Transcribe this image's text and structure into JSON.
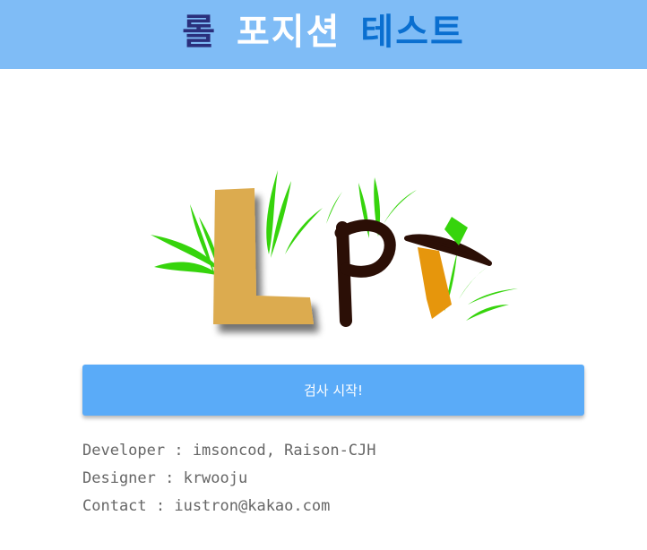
{
  "header": {
    "title_word1": "롤",
    "title_word2": "포지션",
    "title_word3": "테스트",
    "background_color": "#7fbcf6",
    "word_colors": [
      "#2a2f7c",
      "#ffffff",
      "#0a6fd0"
    ]
  },
  "logo": {
    "letters": [
      "L",
      "P",
      "T"
    ],
    "colors": {
      "L": "#dcab4f",
      "P": "#2b0f06",
      "T_bar": "#2b0f06",
      "T_tie": "#e6960c",
      "grass": "#36d40c"
    }
  },
  "main": {
    "start_button_label": "검사 시작!",
    "button_color": "#5aabf8"
  },
  "credits": {
    "developer": "Developer : imsoncod, Raison-CJH",
    "designer": "Designer : krwooju",
    "contact": "Contact : iustron@kakao.com"
  }
}
